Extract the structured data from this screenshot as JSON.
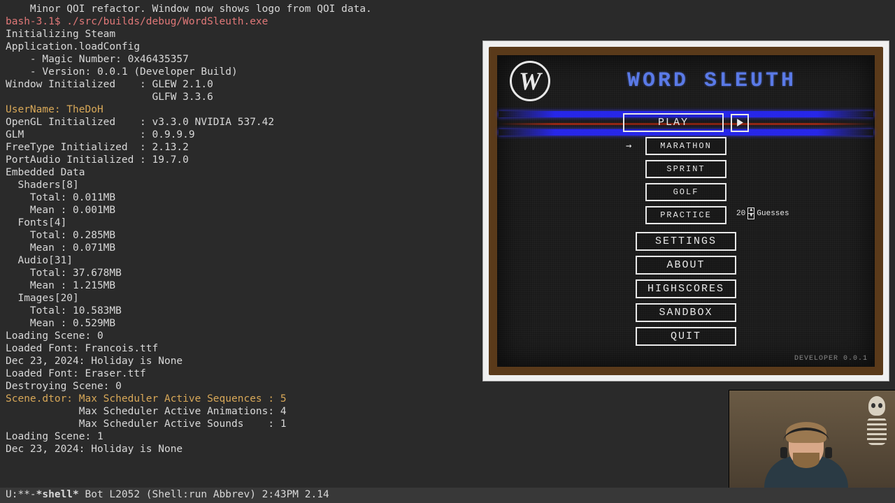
{
  "terminal": {
    "lines": [
      {
        "cls": "",
        "text": "    Minor QOI refactor. Window now shows logo from QOI data."
      },
      {
        "cls": "txt-red",
        "text": "bash-3.1$ ./src/builds/debug/WordSleuth.exe"
      },
      {
        "cls": "",
        "text": "Initializing Steam"
      },
      {
        "cls": "",
        "text": "Application.loadConfig"
      },
      {
        "cls": "",
        "text": "    - Magic Number: 0x46435357"
      },
      {
        "cls": "",
        "text": "    - Version: 0.0.1 (Developer Build)"
      },
      {
        "cls": "",
        "text": "Window Initialized    : GLEW 2.1.0"
      },
      {
        "cls": "",
        "text": "                        GLFW 3.3.6"
      },
      {
        "cls": "txt-orange",
        "text": "UserName: TheDoH"
      },
      {
        "cls": "",
        "text": "OpenGL Initialized    : v3.3.0 NVIDIA 537.42"
      },
      {
        "cls": "",
        "text": "GLM                   : 0.9.9.9"
      },
      {
        "cls": "",
        "text": "FreeType Initialized  : 2.13.2"
      },
      {
        "cls": "",
        "text": "PortAudio Initialized : 19.7.0"
      },
      {
        "cls": "",
        "text": "Embedded Data"
      },
      {
        "cls": "",
        "text": "  Shaders[8]"
      },
      {
        "cls": "",
        "text": "    Total: 0.011MB"
      },
      {
        "cls": "",
        "text": "    Mean : 0.001MB"
      },
      {
        "cls": "",
        "text": "  Fonts[4]"
      },
      {
        "cls": "",
        "text": "    Total: 0.285MB"
      },
      {
        "cls": "",
        "text": "    Mean : 0.071MB"
      },
      {
        "cls": "",
        "text": "  Audio[31]"
      },
      {
        "cls": "",
        "text": "    Total: 37.678MB"
      },
      {
        "cls": "",
        "text": "    Mean : 1.215MB"
      },
      {
        "cls": "",
        "text": "  Images[20]"
      },
      {
        "cls": "",
        "text": "    Total: 10.583MB"
      },
      {
        "cls": "",
        "text": "    Mean : 0.529MB"
      },
      {
        "cls": "",
        "text": "Loading Scene: 0"
      },
      {
        "cls": "",
        "text": "Loaded Font: Francois.ttf"
      },
      {
        "cls": "",
        "text": "Dec 23, 2024: Holiday is None"
      },
      {
        "cls": "",
        "text": "Loaded Font: Eraser.ttf"
      },
      {
        "cls": "",
        "text": "Destroying Scene: 0"
      },
      {
        "cls": "txt-orange",
        "text": "Scene.dtor: Max Scheduler Active Sequences : 5"
      },
      {
        "cls": "",
        "text": "            Max Scheduler Active Animations: 4"
      },
      {
        "cls": "",
        "text": "            Max Scheduler Active Sounds    : 1"
      },
      {
        "cls": "",
        "text": "Loading Scene: 1"
      },
      {
        "cls": "",
        "text": "Dec 23, 2024: Holiday is None"
      }
    ]
  },
  "statusbar": {
    "left": "U:**-",
    "buffer": "*shell*",
    "right": "      Bot L2052  (Shell:run Abbrev) 2:43PM 2.14"
  },
  "game": {
    "logo_letter": "W",
    "title": "WORD SLEUTH",
    "menu": {
      "play": "PLAY",
      "sub": [
        "MARATHON",
        "SPRINT",
        "GOLF",
        "PRACTICE"
      ],
      "main": [
        "SETTINGS",
        "ABOUT",
        "HIGHSCORES",
        "SANDBOX",
        "QUIT"
      ]
    },
    "guesses": {
      "value": "20",
      "label": "Guesses"
    },
    "version": "DEVELOPER 0.0.1"
  }
}
